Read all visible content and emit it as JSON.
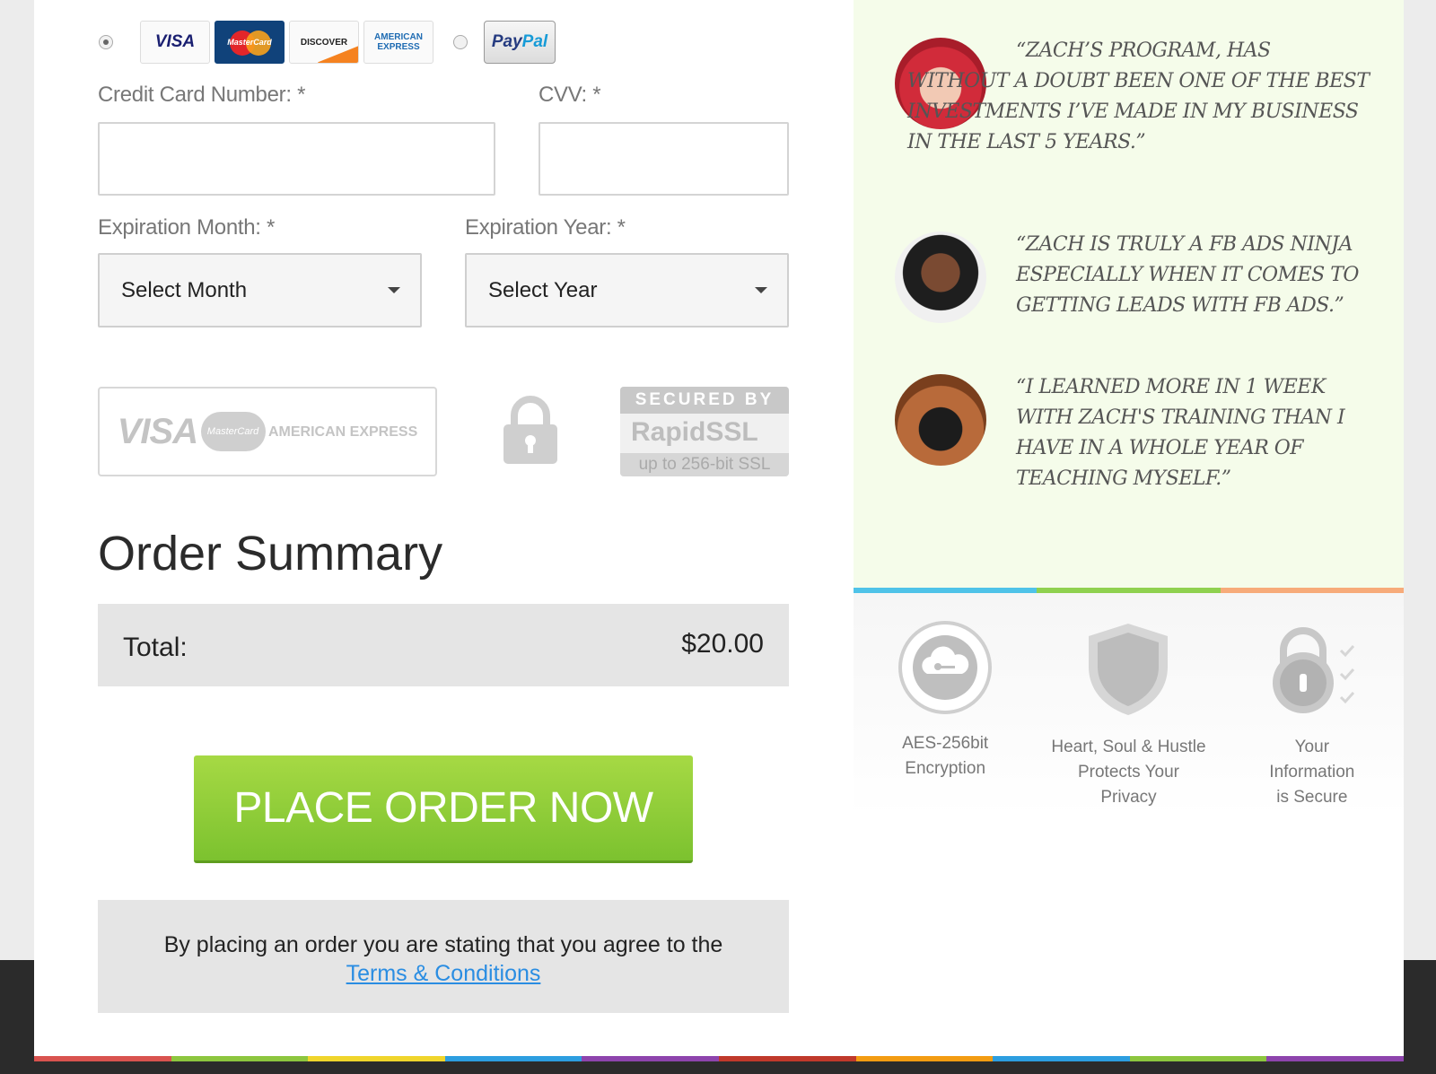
{
  "payment": {
    "card_logos": [
      "VISA",
      "MasterCard",
      "DISCOVER",
      "AMERICAN EXPRESS"
    ],
    "paypal_label_a": "Pay",
    "paypal_label_b": "Pal"
  },
  "form": {
    "card_number_label": "Credit Card Number: *",
    "cvv_label": "CVV: *",
    "exp_month_label": "Expiration Month: *",
    "exp_year_label": "Expiration Year: *",
    "exp_month_value": "Select Month",
    "exp_year_value": "Select Year"
  },
  "badges": {
    "gray_visa": "VISA",
    "gray_mc": "MasterCard",
    "gray_amex": "AMERICAN EXPRESS",
    "ssl_top": "SECURED BY",
    "ssl_brand": "RapidSSL",
    "ssl_bottom": "up to 256-bit SSL"
  },
  "order": {
    "title": "Order Summary",
    "total_label": "Total:",
    "total_value": "$20.00",
    "button_label": "PLACE ORDER NOW",
    "terms_text": "By placing an order you are stating that you agree to the",
    "terms_link": "Terms & Conditions"
  },
  "testimonials": [
    {
      "quote": "“Zach’s program, has without a doubt been one of the best investments I’ve made in my business in the last 5 years.”"
    },
    {
      "quote": "“Zach is truly a FB ads ninja especially when it comes to getting leads with FB ads.”"
    },
    {
      "quote": "“I learned more in 1 week with Zach's training than I have in a whole year of teaching myself.”"
    }
  ],
  "trust": [
    {
      "line1": "AES-256bit",
      "line2": "Encryption",
      "line3": ""
    },
    {
      "line1": "Heart, Soul & Hustle",
      "line2": "Protects Your",
      "line3": "Privacy"
    },
    {
      "line1": "Your",
      "line2": "Information",
      "line3": "is Secure"
    }
  ],
  "colors": {
    "button_green": "#7cc22f",
    "testimonial_bg": "#f5fcea",
    "link_blue": "#2a8de2",
    "stripe": [
      "#4fc3e8",
      "#8fd14f",
      "#f7ab7a"
    ],
    "rainbow": [
      "#d9534f",
      "#8dc63f",
      "#f0d52c",
      "#2d9ee0",
      "#8e44ad",
      "#c0392b",
      "#f39c12",
      "#2d9ee0",
      "#8dc63f",
      "#8e44ad"
    ]
  }
}
